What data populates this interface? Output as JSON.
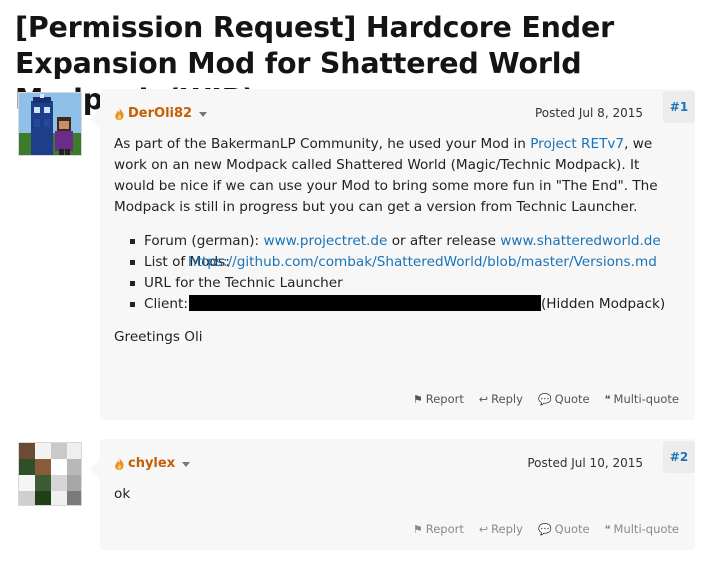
{
  "thread": {
    "title": "[Permission Request] Hardcore Ender Expansion Mod for Shattered World Modpack (WIP)"
  },
  "posts": [
    {
      "username": "DerOli82",
      "posted": "Posted Jul 8, 2015",
      "number": "#1",
      "intro_text_1": "As part of the BakermanLP Community, he used your Mod in ",
      "intro_link": "Project RETv7",
      "intro_text_2": ", we work on an new Modpack called Shattered World (Magic/Technic Modpack). It would be nice if we can use your Mod to bring some more fun in \"The End\". The Modpack is still in progress but you can get a version from Technic Launcher.",
      "list": [
        {
          "prefix": "Forum (german): ",
          "link": "www.projectret.de",
          "middle": " or after release ",
          "link2": "www.shatteredworld.de"
        },
        {
          "prefix": "List of Mods: ",
          "link": "https://github.com/combak/ShatteredWorld/blob/master/Versions.md"
        },
        {
          "prefix": "URL for the Technic Launcher Client: ",
          "suffix": "(Hidden Modpack)"
        }
      ],
      "closing": "Greetings Oli",
      "actions": {
        "report": "Report",
        "reply": "Reply",
        "quote": "Quote",
        "multiquote": "Multi-quote"
      }
    },
    {
      "username": "chylex",
      "posted": "Posted Jul 10, 2015",
      "number": "#2",
      "body": "ok",
      "actions": {
        "report": "Report",
        "reply": "Reply",
        "quote": "Quote",
        "multiquote": "Multi-quote"
      }
    }
  ],
  "colors": {
    "username": "#c45e00",
    "link": "#1a73b8",
    "post_bg": "#f7f7f7"
  },
  "icons": [
    "flame-icon",
    "caret-icon",
    "flag-icon",
    "reply-icon",
    "quote-icon",
    "multiquote-icon"
  ]
}
